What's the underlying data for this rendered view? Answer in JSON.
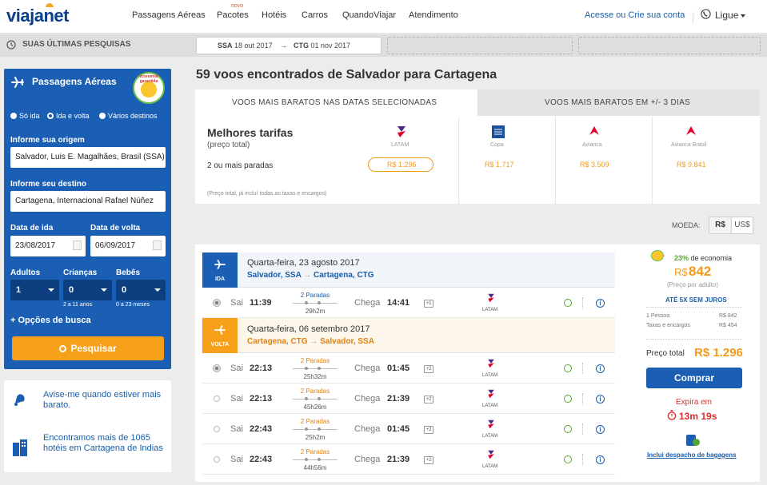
{
  "brand": {
    "logo_a": "viaja",
    "logo_b": "net"
  },
  "nav": {
    "items": [
      "Passagens Aéreas",
      "Pacotes",
      "Hotéis",
      "Carros",
      "QuandoViajar",
      "Atendimento"
    ],
    "novo": "novo",
    "account": "Acesse ou Crie sua conta",
    "call": "Ligue"
  },
  "recent": {
    "label": "SUAS ÚLTIMAS PESQUISAS",
    "search1_from": "SSA",
    "search1_from_date": "18 out 2017",
    "search1_to": "CTG",
    "search1_to_date": "01 nov 2017"
  },
  "sidebar": {
    "title": "Passagens Aéreas",
    "badge": "economia garantida",
    "trip_types": [
      "Só ida",
      "Ida e volta",
      "Vários destinos"
    ],
    "origin_label": "Informe sua origem",
    "origin_value": "Salvador, Luis E. Magalhães, Brasil (SSA)",
    "dest_label": "Informe seu destino",
    "dest_value": "Cartagena, Internacional Rafael Núñez",
    "dep_label": "Data de ida",
    "dep_value": "23/08/2017",
    "ret_label": "Data de volta",
    "ret_value": "06/09/2017",
    "adults_label": "Adultos",
    "adults_value": "1",
    "children_label": "Crianças",
    "children_value": "0",
    "children_note": "2 a 11 anos",
    "babies_label": "Bebês",
    "babies_value": "0",
    "babies_note": "0 a 23 meses",
    "options": "+ Opções de busca",
    "search_button": "Pesquisar"
  },
  "promos": {
    "alert": "Avise-me quando estiver mais barato.",
    "hotels": "Encontramos mais de 1065 hotéis em Cartagena de Indias"
  },
  "results": {
    "title": "59 voos encontrados de Salvador para Cartagena",
    "tab_active": "VOOS MAIS BARATOS NAS DATAS SELECIONADAS",
    "tab_other": "VOOS MAIS BARATOS EM +/- 3 DIAS",
    "best_title": "Melhores tarifas",
    "best_sub": "(preço total)",
    "stops_label": "2 ou mais paradas",
    "note": "(Preço total, já incluí todas as taxas e encargos)",
    "airlines": [
      {
        "name": "LATAM",
        "price": "R$ 1.296"
      },
      {
        "name": "Copa",
        "price": "R$ 1.717"
      },
      {
        "name": "Avianca",
        "price": "R$ 3.509"
      },
      {
        "name": "Avianca Brasil",
        "price": "R$ 9.841"
      }
    ],
    "currency_label": "MOEDA:",
    "currency_brl": "R$",
    "currency_usd": "US$"
  },
  "itinerary": {
    "outbound": {
      "tag": "IDA",
      "date": "Quarta-feira, 23 agosto 2017",
      "from": "Salvador, SSA",
      "to": "Cartagena, CTG"
    },
    "inbound": {
      "tag": "VOLTA",
      "date": "Quarta-feira, 06 setembro 2017",
      "from": "Cartagena, CTG",
      "to": "Salvador, SSA"
    },
    "sai": "Sai",
    "chega": "Chega",
    "out_rows": [
      {
        "dep": "11:39",
        "stops": "2 Paradas",
        "dur": "29h2m",
        "arr": "14:41",
        "plus": "+1",
        "airline": "LATAM"
      }
    ],
    "in_rows": [
      {
        "dep": "22:13",
        "stops": "2 Paradas",
        "dur": "25h32m",
        "arr": "01:45",
        "plus": "+2",
        "airline": "LATAM"
      },
      {
        "dep": "22:13",
        "stops": "2 Paradas",
        "dur": "45h26m",
        "arr": "21:39",
        "plus": "+2",
        "airline": "LATAM"
      },
      {
        "dep": "22:43",
        "stops": "2 Paradas",
        "dur": "25h2m",
        "arr": "01:45",
        "plus": "+2",
        "airline": "LATAM"
      },
      {
        "dep": "22:43",
        "stops": "2 Paradas",
        "dur": "44h56m",
        "arr": "21:39",
        "plus": "+2",
        "airline": "LATAM"
      }
    ]
  },
  "price": {
    "savings": "23%",
    "savings_label": "de economia",
    "per_adult": "842",
    "currency": "R$",
    "per_adult_note": "(Preço por adulto)",
    "installments": "ATÉ 5X SEM JUROS",
    "pax_label": "1 Pessoa",
    "pax_value": "R$ 842",
    "tax_label": "Taxas e encargos",
    "tax_value": "R$ 454",
    "total_label": "Preço total",
    "total_value": "R$ 1.296",
    "buy": "Comprar",
    "expires_label": "Expira em",
    "expires_value": "13m 19s",
    "baggage": "Inclui despacho de bagagens"
  },
  "colors": {
    "brand_blue": "#1a5fb4",
    "orange": "#f7a11a",
    "link": "#1a5ea8",
    "red": "#d9302c"
  }
}
